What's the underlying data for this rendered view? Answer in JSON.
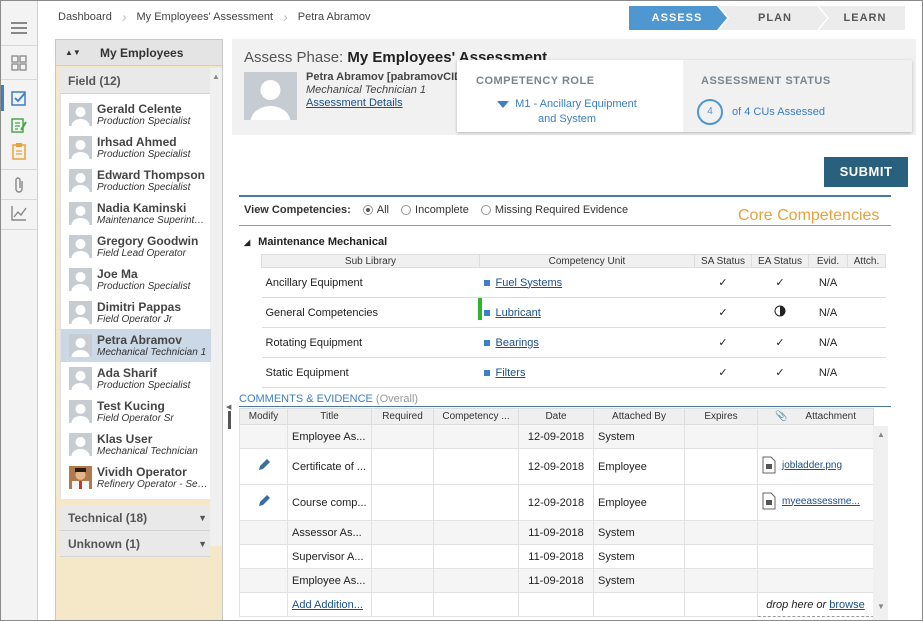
{
  "breadcrumb": [
    "Dashboard",
    "My Employees' Assessment",
    "Petra Abramov"
  ],
  "phases": [
    {
      "label": "ASSESS",
      "active": true
    },
    {
      "label": "PLAN",
      "active": false
    },
    {
      "label": "LEARN",
      "active": false
    }
  ],
  "left_panel": {
    "title": "My Employees",
    "groups": {
      "field": "Field (12)",
      "technical": "Technical (18)",
      "unknown": "Unknown (1)"
    },
    "employees": [
      {
        "name": "Gerald Celente",
        "role": "Production Specialist"
      },
      {
        "name": "Irhsad Ahmed",
        "role": "Production Specialist"
      },
      {
        "name": "Edward Thompson",
        "role": "Production Specialist"
      },
      {
        "name": "Nadia Kaminski",
        "role": "Maintenance Superintendent"
      },
      {
        "name": "Gregory Goodwin",
        "role": "Field Lead Operator"
      },
      {
        "name": "Joe Ma",
        "role": "Production Specialist"
      },
      {
        "name": "Dimitri Pappas",
        "role": "Field Operator Jr"
      },
      {
        "name": "Petra Abramov",
        "role": "Mechanical Technician 1",
        "selected": true
      },
      {
        "name": "Ada Sharif",
        "role": "Production Specialist"
      },
      {
        "name": "Test Kucing",
        "role": "Field Operator Sr"
      },
      {
        "name": "Klas User",
        "role": "Mechanical Technician"
      },
      {
        "name": "Vividh Operator",
        "role": "Refinery Operator - Senior",
        "photo": true
      }
    ]
  },
  "header": {
    "phase_label": "Assess Phase:",
    "page_title": "My Employees' Assessment",
    "person_name": "Petra Abramov [pabramovCID",
    "person_title": "Mechanical Technician 1",
    "details_link": "Assessment Details"
  },
  "competency_role": {
    "label": "COMPETENCY ROLE",
    "value": "M1 - Ancillary Equipment and System"
  },
  "assessment_status": {
    "label": "ASSESSMENT STATUS",
    "count": "4",
    "text": "of 4 CUs Assessed"
  },
  "submit_label": "SUBMIT",
  "view_competencies": {
    "label": "View Competencies:",
    "options": [
      "All",
      "Incomplete",
      "Missing Required Evidence"
    ],
    "selected": "All"
  },
  "core_competencies_label": "Core Competencies",
  "section_title": "Maintenance Mechanical",
  "cu_table": {
    "headers": [
      "Sub Library",
      "Competency Unit",
      "SA Status",
      "EA Status",
      "Evid.",
      "Attch."
    ],
    "rows": [
      {
        "sub": "Ancillary Equipment",
        "unit": "Fuel Systems",
        "sa": "✓",
        "ea": "✓",
        "evid": "N/A",
        "attch": ""
      },
      {
        "sub": "General Competencies",
        "unit": "Lubricant",
        "sa": "✓",
        "ea": "half",
        "evid": "N/A",
        "attch": ""
      },
      {
        "sub": "Rotating Equipment",
        "unit": "Bearings",
        "sa": "✓",
        "ea": "✓",
        "evid": "N/A",
        "attch": ""
      },
      {
        "sub": "Static Equipment",
        "unit": "Filters",
        "sa": "✓",
        "ea": "✓",
        "evid": "N/A",
        "attch": ""
      }
    ]
  },
  "comments": {
    "title": "COMMENTS & EVIDENCE",
    "subtitle": "(Overall)",
    "headers": [
      "Modify",
      "Title",
      "Required",
      "Competency ...",
      "Date",
      "Attached By",
      "Expires",
      "Attachment"
    ],
    "rows": [
      {
        "edit": false,
        "title": "Employee As...",
        "date": "12-09-2018",
        "by": "System",
        "file": ""
      },
      {
        "edit": true,
        "title": "Certificate of ...",
        "date": "12-09-2018",
        "by": "Employee",
        "file": "jobladder.png"
      },
      {
        "edit": true,
        "title": "Course comp...",
        "date": "12-09-2018",
        "by": "Employee",
        "file": "myeeassessme..."
      },
      {
        "edit": false,
        "title": "Assessor As...",
        "date": "11-09-2018",
        "by": "System",
        "file": ""
      },
      {
        "edit": false,
        "title": "Supervisor A...",
        "date": "11-09-2018",
        "by": "System",
        "file": ""
      },
      {
        "edit": false,
        "title": "Employee As...",
        "date": "11-09-2018",
        "by": "System",
        "file": ""
      }
    ],
    "add_link": "Add Addition...",
    "drop_text": "drop here or",
    "browse_link": "browse"
  },
  "colors": {
    "accent": "#4f97d1",
    "submit": "#28607d",
    "core": "#e8a23a",
    "panel": "#f5e8c8"
  }
}
